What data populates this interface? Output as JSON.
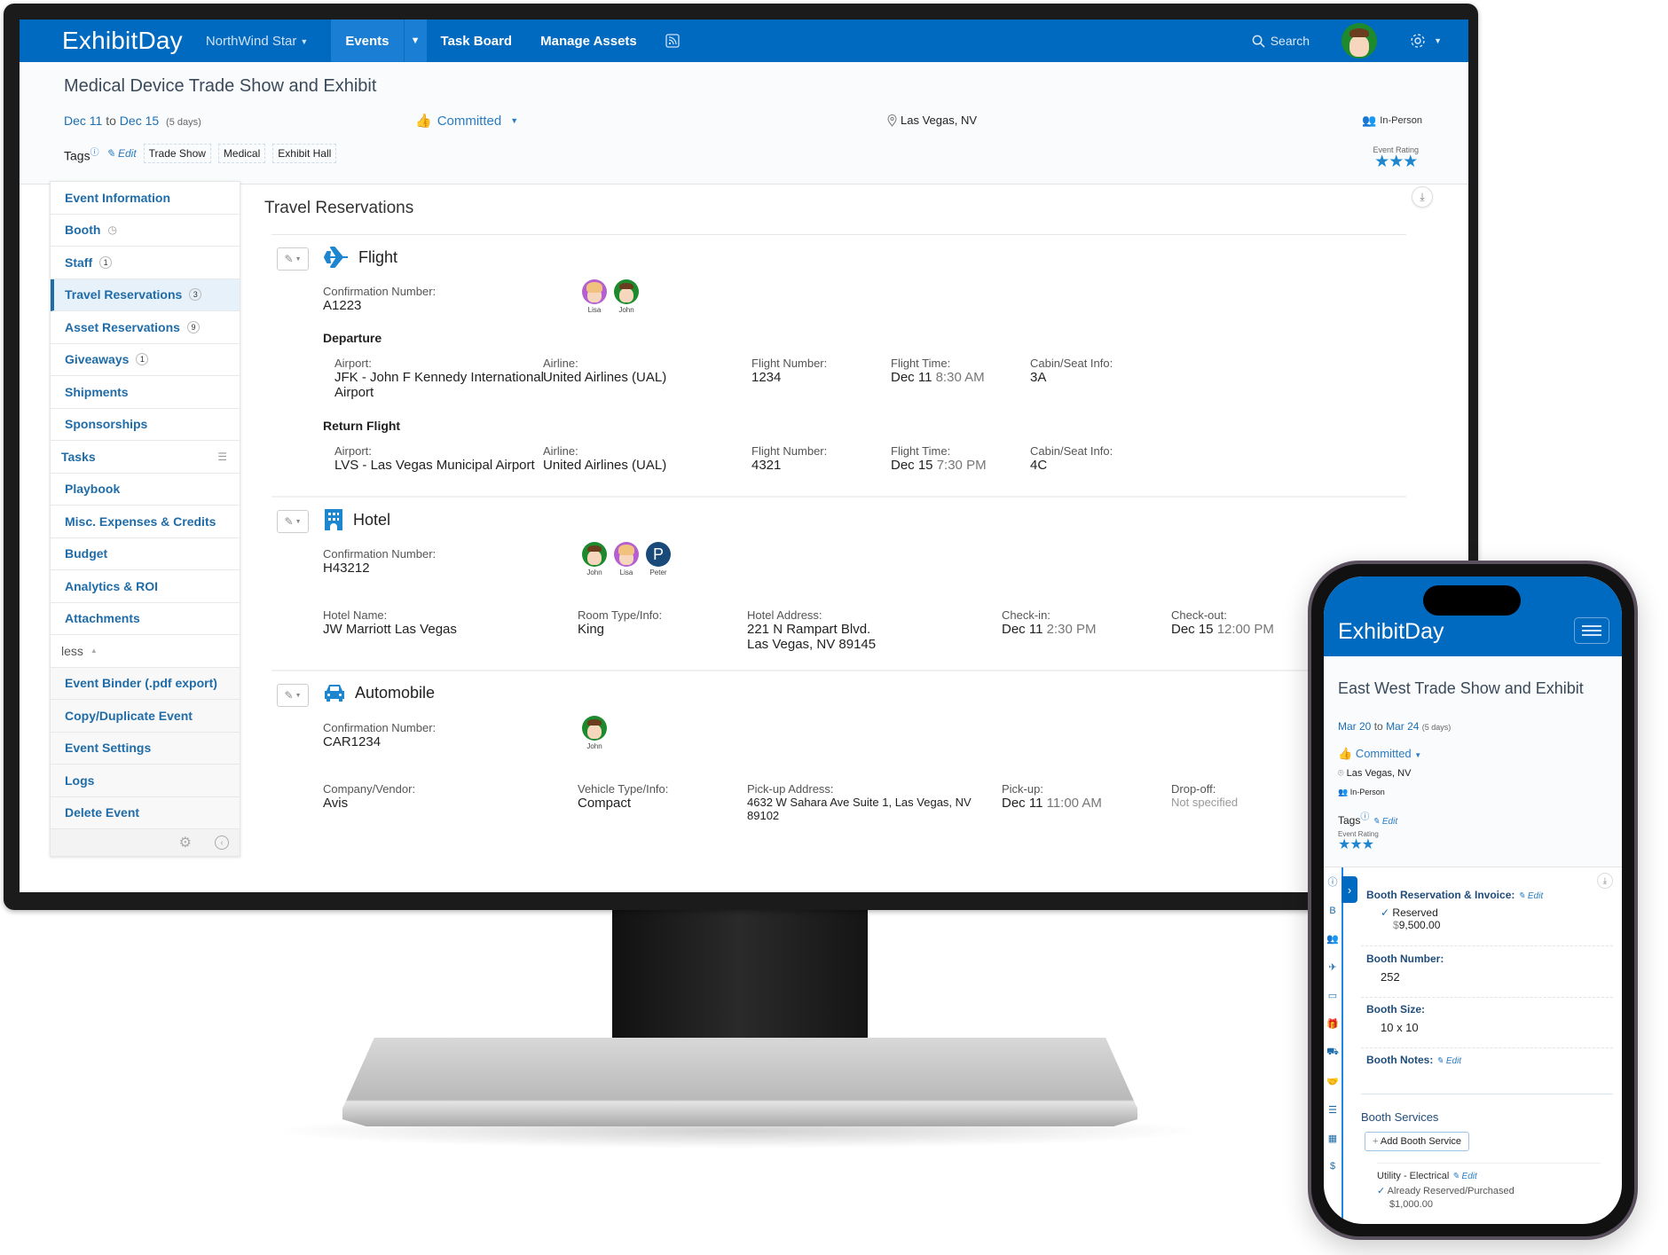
{
  "desktop": {
    "nav": {
      "logo": "ExhibitDay",
      "org": "NorthWind Star",
      "tabs": [
        {
          "label": "Events",
          "active": true
        },
        {
          "label": "Task Board"
        },
        {
          "label": "Manage Assets"
        }
      ],
      "search_label": "Search",
      "feed_icon": "rss-icon",
      "settings_icon": "gear-icon"
    },
    "event": {
      "title": "Medical Device Trade Show and Exhibit",
      "start": "Dec 11",
      "to": "to",
      "end": "Dec 15",
      "duration": "(5 days)",
      "status": "Committed",
      "location": "Las Vegas, NV",
      "format": "In-Person",
      "rating_label": "Event Rating",
      "rating": 3,
      "tags_label": "Tags",
      "edit_label": "Edit",
      "tags": [
        "Trade Show",
        "Medical",
        "Exhibit Hall"
      ]
    },
    "sidebar": {
      "items": [
        {
          "label": "Event Information"
        },
        {
          "label": "Booth",
          "icon": "clock-icon"
        },
        {
          "label": "Staff",
          "badge": "1"
        },
        {
          "label": "Travel Reservations",
          "badge": "3",
          "active": true
        },
        {
          "label": "Asset Reservations",
          "badge": "9"
        },
        {
          "label": "Giveaways",
          "badge": "1"
        },
        {
          "label": "Shipments"
        },
        {
          "label": "Sponsorships"
        },
        {
          "label": "Tasks",
          "icon": "checklist-icon"
        },
        {
          "label": "Playbook"
        },
        {
          "label": "Misc. Expenses & Credits"
        },
        {
          "label": "Budget"
        },
        {
          "label": "Analytics & ROI"
        },
        {
          "label": "Attachments"
        }
      ],
      "less_label": "less",
      "actions": [
        {
          "label": "Event Binder (.pdf export)"
        },
        {
          "label": "Copy/Duplicate Event"
        },
        {
          "label": "Event Settings"
        },
        {
          "label": "Logs"
        },
        {
          "label": "Delete Event"
        }
      ]
    },
    "travel": {
      "heading": "Travel Reservations",
      "flight": {
        "title": "Flight",
        "conf_label": "Confirmation Number:",
        "conf": "A1223",
        "travelers": [
          "Lisa",
          "John"
        ],
        "departure_label": "Departure",
        "return_label": "Return Flight",
        "departure": {
          "airport_label": "Airport:",
          "airport": "JFK - John F Kennedy International Airport",
          "airline_label": "Airline:",
          "airline": "United Airlines (UAL)",
          "number_label": "Flight Number:",
          "number": "1234",
          "time_label": "Flight Time:",
          "date": "Dec 11",
          "time": "8:30 AM",
          "seat_label": "Cabin/Seat Info:",
          "seat": "3A"
        },
        "return": {
          "airport_label": "Airport:",
          "airport": "LVS - Las Vegas Municipal Airport",
          "airline_label": "Airline:",
          "airline": "United Airlines (UAL)",
          "number_label": "Flight Number:",
          "number": "4321",
          "time_label": "Flight Time:",
          "date": "Dec 15",
          "time": "7:30 PM",
          "seat_label": "Cabin/Seat Info:",
          "seat": "4C"
        }
      },
      "hotel": {
        "title": "Hotel",
        "conf_label": "Confirmation Number:",
        "conf": "H43212",
        "travelers": [
          "John",
          "Lisa",
          "Peter"
        ],
        "name_label": "Hotel Name:",
        "name": "JW Marriott Las Vegas",
        "room_label": "Room Type/Info:",
        "room": "King",
        "address_label": "Hotel Address:",
        "address1": "221 N Rampart Blvd.",
        "address2": "Las Vegas, NV 89145",
        "checkin_label": "Check-in:",
        "checkin_date": "Dec 11",
        "checkin_time": "2:30 PM",
        "checkout_label": "Check-out:",
        "checkout_date": "Dec 15",
        "checkout_time": "12:00 PM"
      },
      "auto": {
        "title": "Automobile",
        "conf_label": "Confirmation Number:",
        "conf": "CAR1234",
        "travelers": [
          "John"
        ],
        "vendor_label": "Company/Vendor:",
        "vendor": "Avis",
        "vehicle_label": "Vehicle Type/Info:",
        "vehicle": "Compact",
        "pickup_addr_label": "Pick-up Address:",
        "pickup_addr": "4632 W Sahara Ave Suite 1, Las Vegas, NV 89102",
        "pickup_label": "Pick-up:",
        "pickup_date": "Dec 11",
        "pickup_time": "11:00 AM",
        "dropoff_label": "Drop-off:",
        "dropoff": "Not specified"
      }
    }
  },
  "mobile": {
    "logo": "ExhibitDay",
    "event": {
      "title": "East West Trade Show and Exhibit",
      "start": "Mar 20",
      "to": "to",
      "end": "Mar 24",
      "duration": "(5 days)",
      "status": "Committed",
      "location": "Las Vegas, NV",
      "format": "In-Person",
      "tags_label": "Tags",
      "edit_label": "Edit",
      "rating_label": "Event Rating",
      "rating": 3
    },
    "booth": {
      "reservation_label": "Booth Reservation & Invoice:",
      "reservation_status": "Reserved",
      "reservation_amount": "9,500.00",
      "number_label": "Booth Number:",
      "number": "252",
      "size_label": "Booth Size:",
      "size": "10 x 10",
      "notes_label": "Booth Notes:",
      "services_heading": "Booth Services",
      "add_service_label": "Add Booth Service",
      "service_name": "Utility - Electrical",
      "service_status": "Already Reserved/Purchased",
      "service_amount": "1,000.00",
      "currency": "$"
    }
  },
  "colors": {
    "brand": "#0069c0",
    "link": "#1f6ca8",
    "star": "#1e86cf"
  }
}
